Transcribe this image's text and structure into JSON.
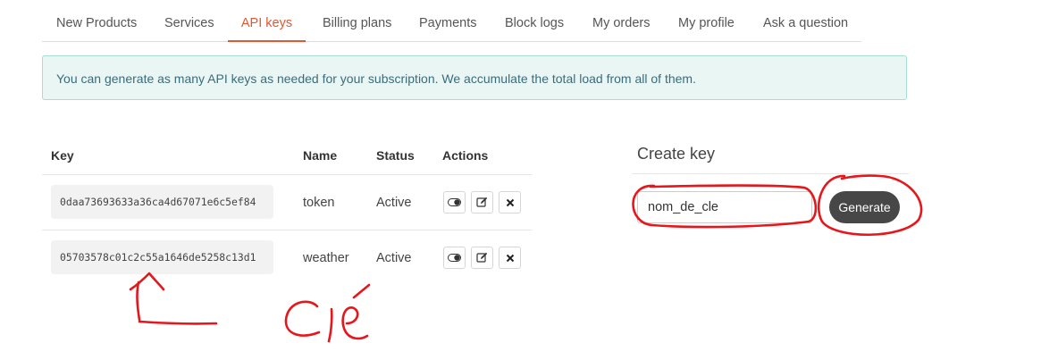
{
  "tabs": [
    {
      "label": "New Products"
    },
    {
      "label": "Services"
    },
    {
      "label": "API keys",
      "active": true
    },
    {
      "label": "Billing plans"
    },
    {
      "label": "Payments"
    },
    {
      "label": "Block logs"
    },
    {
      "label": "My orders"
    },
    {
      "label": "My profile"
    },
    {
      "label": "Ask a question"
    }
  ],
  "alert": {
    "text": "You can generate as many API keys as needed for your subscription. We accumulate the total load from all of them."
  },
  "table": {
    "headers": {
      "key": "Key",
      "name": "Name",
      "status": "Status",
      "actions": "Actions"
    },
    "rows": [
      {
        "key": "0daa73693633a36ca4d67071e6c5ef84",
        "name": "token",
        "status": "Active"
      },
      {
        "key": "05703578c01c2c55a1646de5258c13d1",
        "name": "weather",
        "status": "Active"
      }
    ]
  },
  "create": {
    "title": "Create key",
    "input_value": "nom_de_cle",
    "button_label": "Generate"
  },
  "annotation": {
    "handwritten_text": "Clé",
    "color": "#e8151b"
  },
  "colors": {
    "accent": "#e4572e",
    "alert_bg": "#eaf6f4",
    "alert_border": "#a8ddd3",
    "button_bg": "#474747"
  },
  "icons": {
    "toggle": "toggle-icon",
    "edit": "edit-icon",
    "delete": "close-icon"
  }
}
